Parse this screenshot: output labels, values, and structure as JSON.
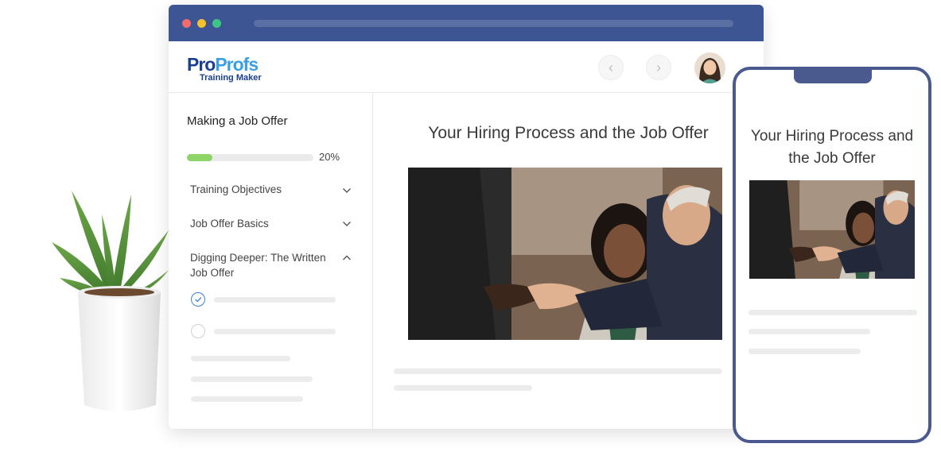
{
  "app": {
    "logo_part1": "Pro",
    "logo_part2": "Profs",
    "logo_sub": "Training Maker"
  },
  "navigation": {
    "prev_icon": "chevron-left-icon",
    "next_icon": "chevron-right-icon"
  },
  "course": {
    "title": "Making a Job Offer",
    "progress_fraction": 0.2,
    "progress_label": "20%",
    "sections": [
      {
        "label": "Training Objectives",
        "expanded": false
      },
      {
        "label": "Job Offer Basics",
        "expanded": false
      },
      {
        "label": "Digging Deeper: The Written Job Offer",
        "expanded": true
      }
    ],
    "lessons": [
      {
        "status": "completed"
      },
      {
        "status": "not-started"
      }
    ]
  },
  "content": {
    "title": "Your Hiring Process and the Job Offer"
  },
  "mobile": {
    "title": "Your Hiring Process and the Job Offer"
  },
  "colors": {
    "browser_bar": "#3d5592",
    "progress": "#8fd468",
    "phone_frame": "#4a5a8e",
    "check": "#3b7ed6"
  }
}
